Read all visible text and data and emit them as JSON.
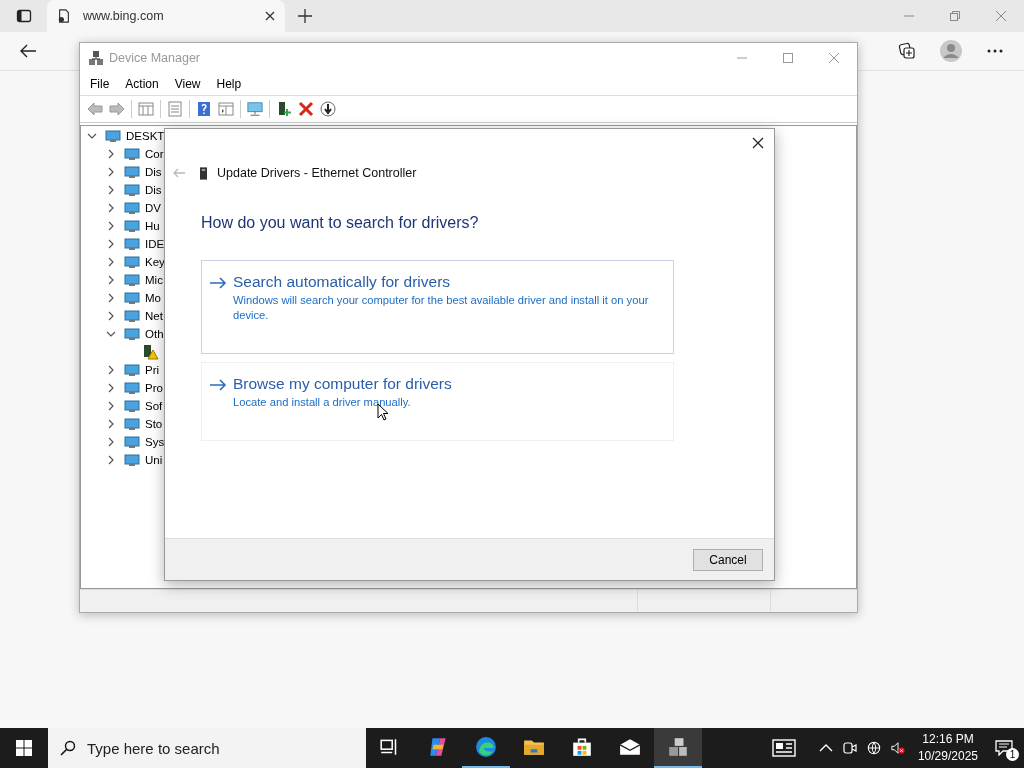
{
  "browser": {
    "tabs": [
      {
        "title": "www.bing.com",
        "selected": true
      }
    ]
  },
  "device_manager": {
    "title": "Device Manager",
    "active": false,
    "menu": [
      "File",
      "Action",
      "View",
      "Help"
    ],
    "toolbar": [
      {
        "kind": "back"
      },
      {
        "kind": "forward"
      },
      {
        "kind": "sep"
      },
      {
        "kind": "grid"
      },
      {
        "kind": "sep"
      },
      {
        "kind": "sheet"
      },
      {
        "kind": "sep"
      },
      {
        "kind": "help"
      },
      {
        "kind": "panel"
      },
      {
        "kind": "sep"
      },
      {
        "kind": "scan"
      },
      {
        "kind": "sep"
      },
      {
        "kind": "add"
      },
      {
        "kind": "remove"
      },
      {
        "kind": "down"
      }
    ],
    "tree": [
      {
        "label": "DESKT",
        "expanded": true,
        "children": [
          {
            "label": "Cor",
            "expanded": false
          },
          {
            "label": "Dis",
            "expanded": false
          },
          {
            "label": "Dis",
            "expanded": false
          },
          {
            "label": "DV",
            "expanded": false
          },
          {
            "label": "Hu",
            "expanded": false
          },
          {
            "label": "IDE",
            "expanded": false
          },
          {
            "label": "Key",
            "expanded": false
          },
          {
            "label": "Mic",
            "expanded": false
          },
          {
            "label": "Mo",
            "expanded": false
          },
          {
            "label": "Net",
            "expanded": false
          },
          {
            "label": "Oth",
            "expanded": true,
            "children": [
              {
                "warning": true
              }
            ]
          },
          {
            "label": "Pri",
            "expanded": false
          },
          {
            "label": "Pro",
            "expanded": false
          },
          {
            "label": "Sof",
            "expanded": false
          },
          {
            "label": "Sto",
            "expanded": false
          },
          {
            "label": "Sys",
            "expanded": false
          },
          {
            "label": "Uni",
            "expanded": false
          }
        ]
      }
    ]
  },
  "dialog": {
    "title": "Update Drivers - Ethernet Controller",
    "heading": "How do you want to search for drivers?",
    "options": [
      {
        "title": "Search automatically for drivers",
        "description": "Windows will search your computer for the best available driver and install it on your device.",
        "focused": true
      },
      {
        "title": "Browse my computer for drivers",
        "description": "Locate and install a driver manually.",
        "focused": false
      }
    ],
    "buttons": [
      "Cancel"
    ]
  },
  "taskbar": {
    "search": {
      "placeholder": "Type here to search"
    },
    "apps": [
      {
        "kind": "taskview",
        "running": false,
        "active": false
      },
      {
        "kind": "copilot",
        "running": false,
        "active": false
      },
      {
        "kind": "edge",
        "running": true,
        "active": false
      },
      {
        "kind": "folder",
        "running": false,
        "active": false
      },
      {
        "kind": "store",
        "running": false,
        "active": false
      },
      {
        "kind": "mail",
        "running": false,
        "active": false
      },
      {
        "kind": "devmgr",
        "running": true,
        "active": true
      }
    ],
    "time": "12:16 PM",
    "date": "10/29/2025",
    "notifications": "1"
  }
}
